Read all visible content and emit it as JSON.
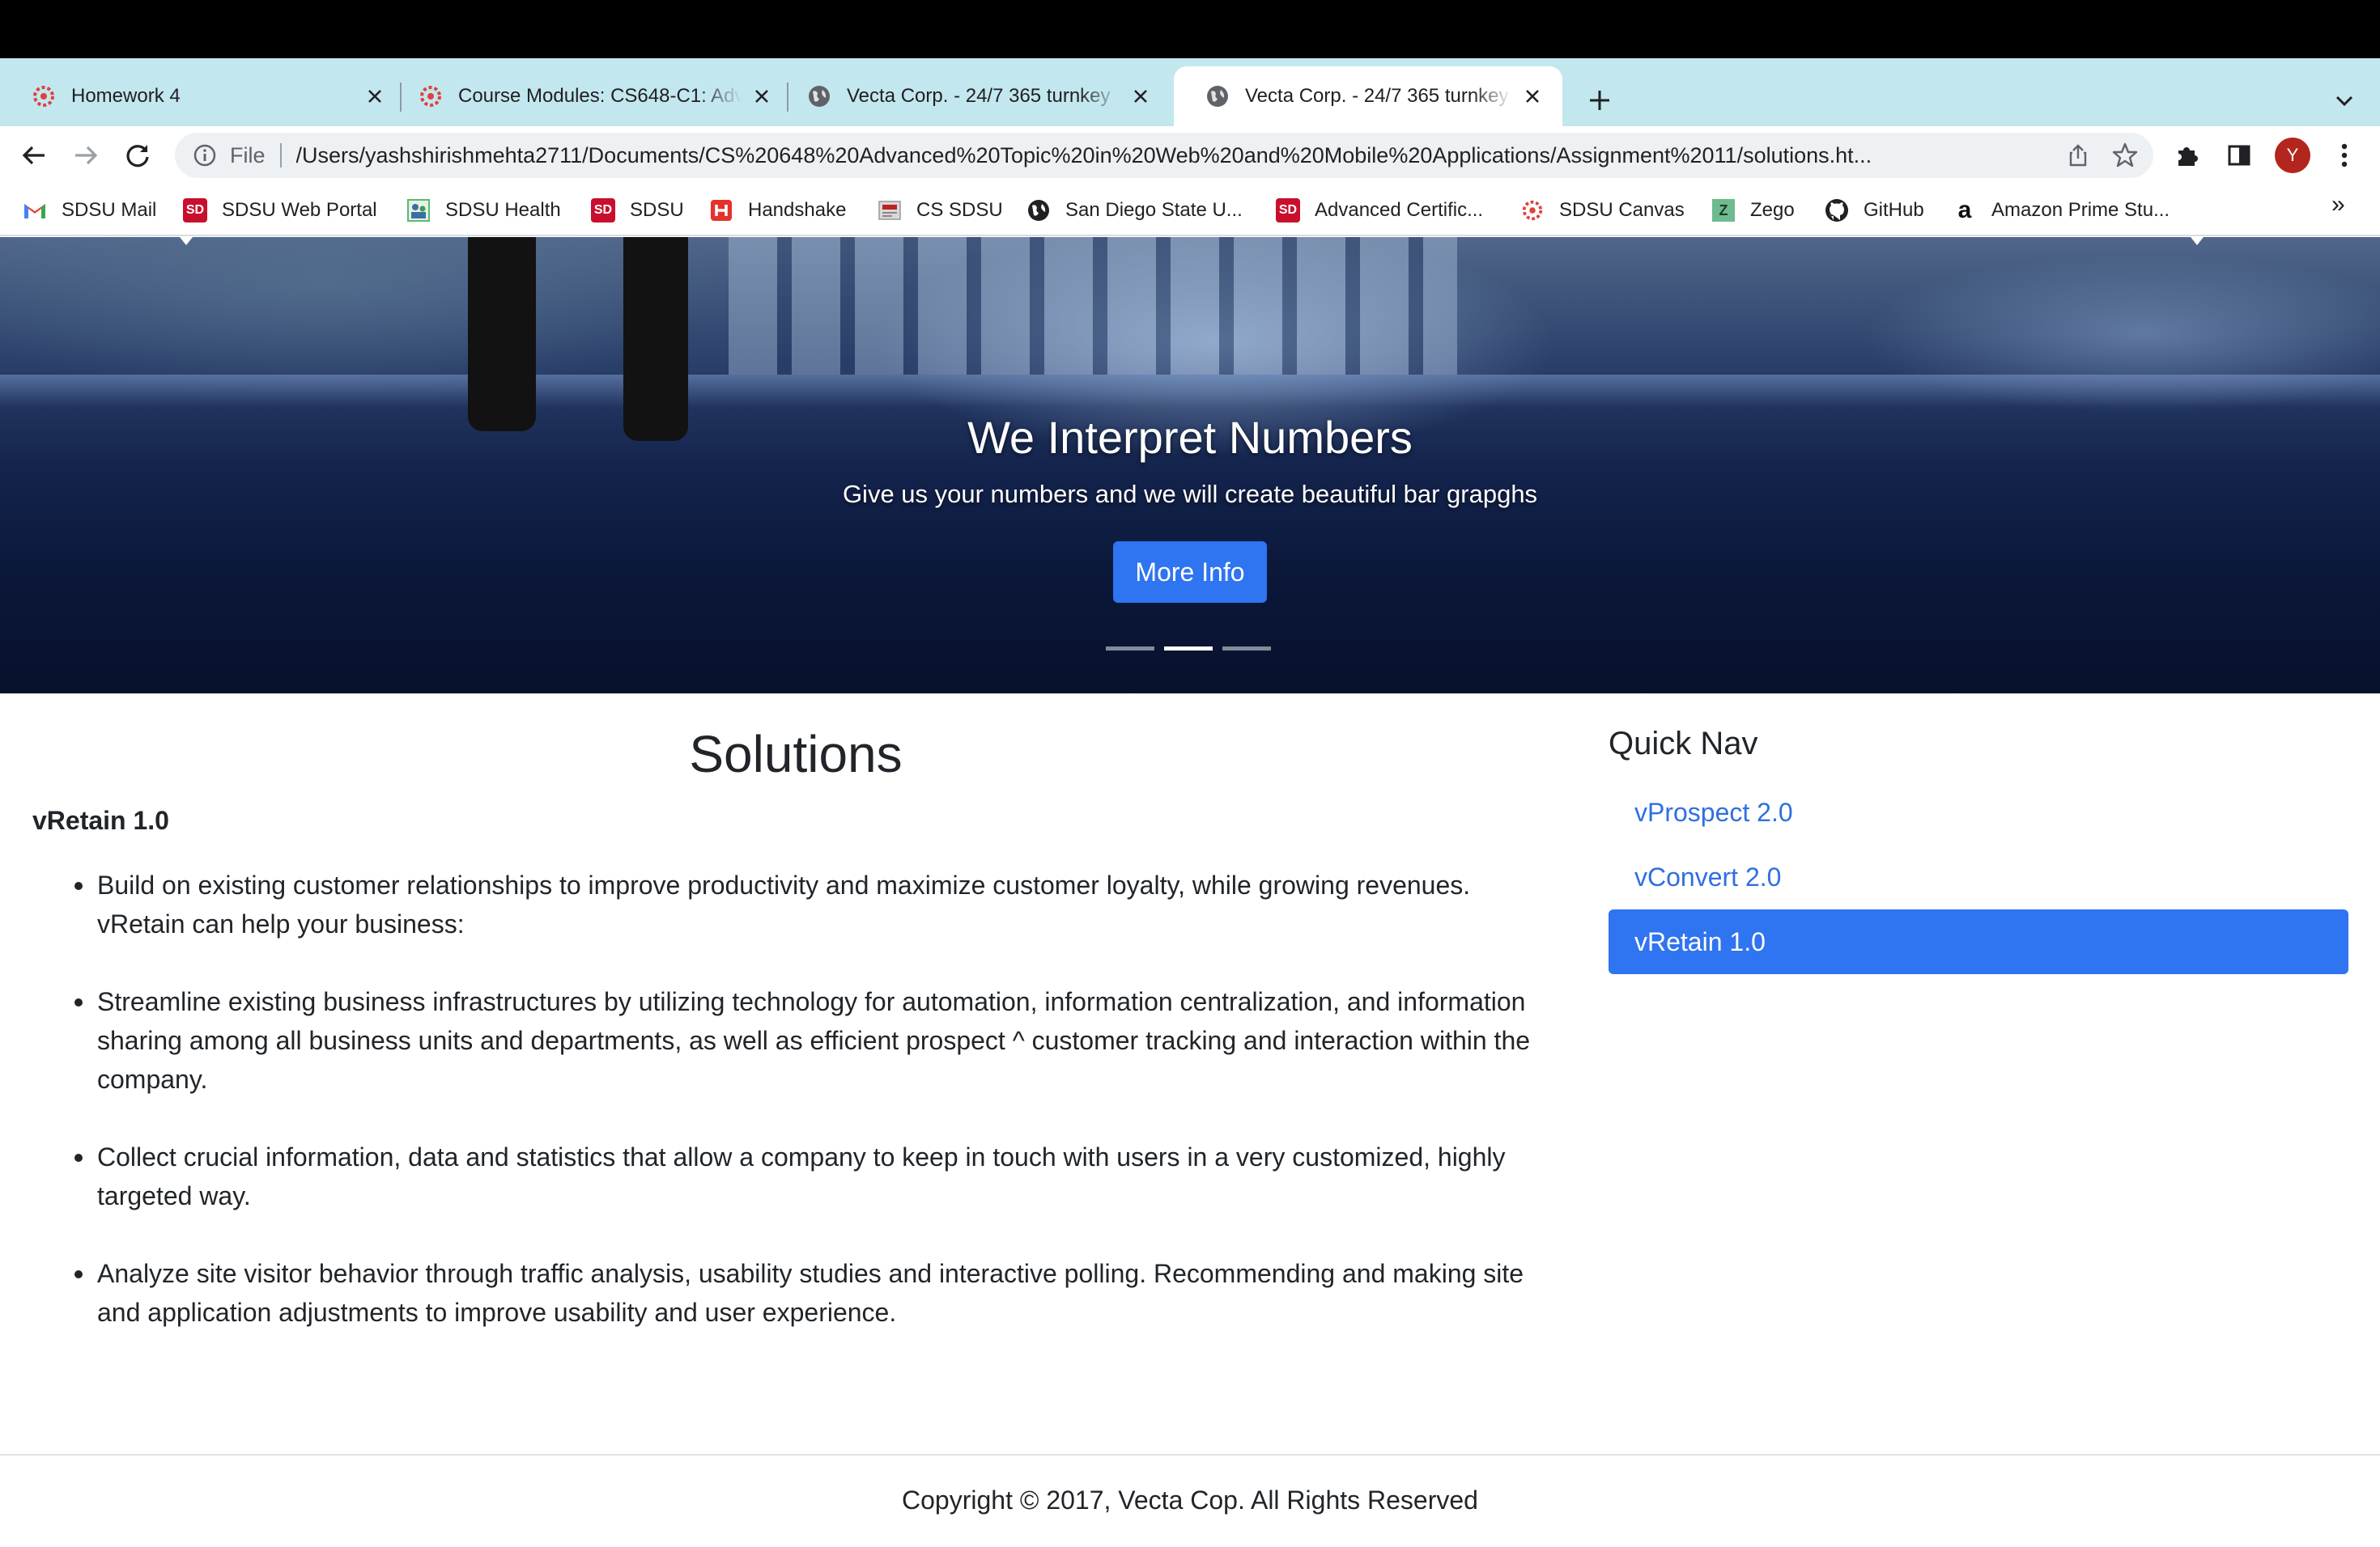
{
  "browser": {
    "tabs": [
      {
        "title": "Homework 4",
        "icon": "canvas-icon",
        "active": false
      },
      {
        "title": "Course Modules: CS648-C1: Adv",
        "icon": "canvas-icon",
        "active": false
      },
      {
        "title": "Vecta Corp. - 24/7 365 turnkey",
        "icon": "globe-icon",
        "active": false
      },
      {
        "title": "Vecta Corp. - 24/7 365 turnkey",
        "icon": "globe-icon",
        "active": true
      }
    ],
    "address": {
      "scheme": "File",
      "url": "/Users/yashshirishmehta2711/Documents/CS%20648%20Advanced%20Topic%20in%20Web%20and%20Mobile%20Applications/Assignment%2011/solutions.ht..."
    },
    "profile_initial": "Y",
    "bookmarks": [
      {
        "label": "SDSU Mail",
        "icon": "gmail-icon"
      },
      {
        "label": "SDSU Web Portal",
        "icon": "sd-icon"
      },
      {
        "label": "SDSU Health",
        "icon": "health-icon"
      },
      {
        "label": "SDSU",
        "icon": "sd-icon"
      },
      {
        "label": "Handshake",
        "icon": "handshake-icon"
      },
      {
        "label": "CS SDSU",
        "icon": "cs-icon"
      },
      {
        "label": "San Diego State U...",
        "icon": "globe-icon"
      },
      {
        "label": "Advanced Certific...",
        "icon": "sd-icon"
      },
      {
        "label": "SDSU Canvas",
        "icon": "canvas-icon"
      },
      {
        "label": "Zego",
        "icon": "zego-icon"
      },
      {
        "label": "GitHub",
        "icon": "github-icon"
      },
      {
        "label": "Amazon Prime Stu...",
        "icon": "amazon-icon"
      }
    ],
    "bookmarks_overflow": "»",
    "sd_badge": "SD",
    "zego_letter": "Z",
    "amazon_letter": "a"
  },
  "hero": {
    "title": "We Interpret Numbers",
    "subtitle": "Give us your numbers and we will create beautiful bar grapghs",
    "button": "More Info",
    "slide_count": 3,
    "active_slide": 2
  },
  "main": {
    "title": "Solutions",
    "product": "vRetain 1.0",
    "bullets": [
      "Build on existing customer relationships to improve productivity and maximize customer loyalty, while growing revenues. vRetain can help your business:",
      "Streamline existing business infrastructures by utilizing technology for automation, information centralization, and information sharing among all business units and departments, as well as efficient prospect ^ customer tracking and interaction within the company.",
      "Collect crucial information, data and statistics that allow a company to keep in touch with users in a very customized, highly targeted way.",
      "Analyze site visitor behavior through traffic analysis, usability studies and interactive polling. Recommending and making site and application adjustments to improve usability and user experience."
    ]
  },
  "sidebar": {
    "title": "Quick Nav",
    "items": [
      {
        "label": "vProspect 2.0",
        "active": false
      },
      {
        "label": "vConvert 2.0",
        "active": false
      },
      {
        "label": "vRetain 1.0",
        "active": true
      }
    ]
  },
  "footer": {
    "text": "Copyright © 2017, Vecta Cop. All Rights Reserved"
  },
  "colors": {
    "tabstrip": "#c3e7ef",
    "accent": "#2f74f0",
    "link": "#2f6fe0"
  }
}
